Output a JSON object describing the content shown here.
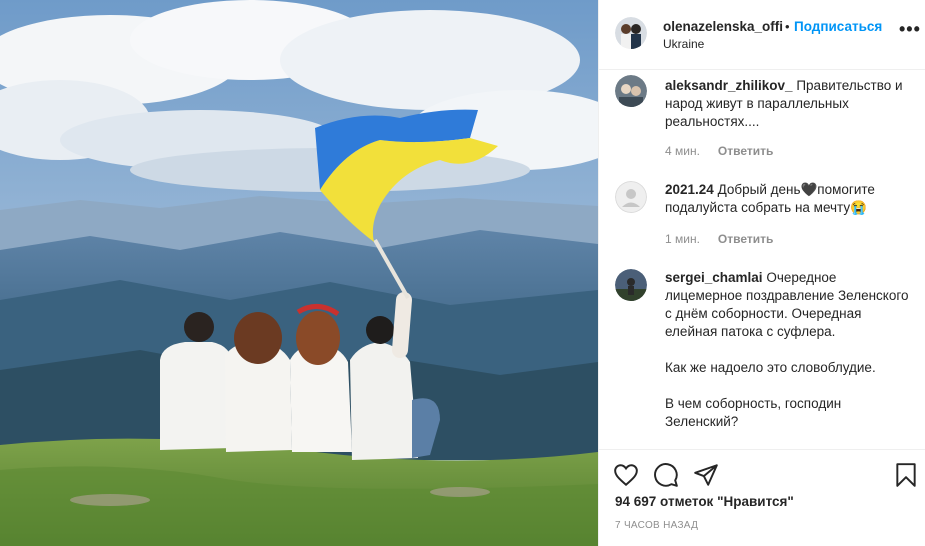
{
  "post": {
    "author": "olenazelenska_offi",
    "separator": "•",
    "follow_label": "Подписаться",
    "location": "Ukraine",
    "more_label": "•••",
    "photo_icon": "photo-of-people-with-ukrainian-flag"
  },
  "comments": [
    {
      "user": "aleksandr_zhilikov_",
      "text": "Правительство и народ живут в параллельных реальностях....",
      "time": "4 мин.",
      "reply": "Ответить"
    },
    {
      "user": "2021.24",
      "text": "Добрый день🖤помогите подалуйста собрать на мечту😭",
      "time": "1 мин.",
      "reply": "Ответить"
    },
    {
      "user": "sergei_chamlai",
      "text": "Очередное лицемерное поздравление Зеленского с днём соборности. Очередная елейная патока с суфлера.\n\nКак же надоело это словоблудие.\n\nВ чем соборность, господин Зеленский?"
    }
  ],
  "actions": {
    "icons": [
      "heart-icon",
      "comment-icon",
      "share-icon",
      "bookmark-icon"
    ],
    "likes": "94 697 отметок \"Нравится\"",
    "time": "7 часов назад"
  },
  "colors": {
    "link_blue": "#0095f6",
    "meta_gray": "#8e8e8e",
    "border": "#efefef",
    "flag_blue": "#2f7bd9",
    "flag_yellow": "#f2e03a"
  }
}
